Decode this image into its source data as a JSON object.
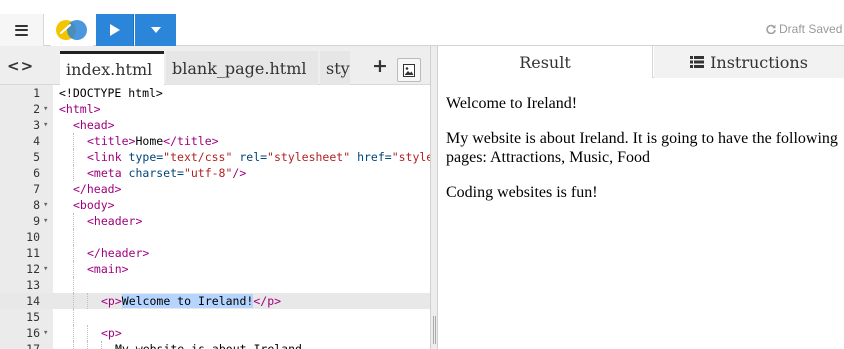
{
  "toolbar": {
    "run_label": "Run",
    "draft_status": "Draft Saved"
  },
  "editor": {
    "tabs": [
      "index.html",
      "blank_page.html",
      "style.css"
    ],
    "lines": [
      {
        "n": "1",
        "fold": "",
        "indent": 0,
        "tokens": [
          [
            "tx",
            "<!DOCTYPE html>"
          ]
        ]
      },
      {
        "n": "2",
        "fold": "▾",
        "indent": 0,
        "tokens": [
          [
            "tg",
            "<html>"
          ]
        ]
      },
      {
        "n": "3",
        "fold": "▾",
        "indent": 1,
        "tokens": [
          [
            "tg",
            "<head>"
          ]
        ]
      },
      {
        "n": "4",
        "fold": "",
        "indent": 2,
        "tokens": [
          [
            "tg",
            "<title>"
          ],
          [
            "tx",
            "Home"
          ],
          [
            "tg",
            "</title>"
          ]
        ]
      },
      {
        "n": "5",
        "fold": "",
        "indent": 2,
        "tokens": [
          [
            "tg",
            "<link "
          ],
          [
            "at",
            "type="
          ],
          [
            "st",
            "\"text/css\""
          ],
          [
            "at",
            " rel="
          ],
          [
            "st",
            "\"stylesheet\""
          ],
          [
            "at",
            " href="
          ],
          [
            "st",
            "\"style.css\""
          ],
          [
            "tg",
            ">"
          ]
        ]
      },
      {
        "n": "6",
        "fold": "",
        "indent": 2,
        "tokens": [
          [
            "tg",
            "<meta "
          ],
          [
            "at",
            "charset="
          ],
          [
            "st",
            "\"utf-8\""
          ],
          [
            "tg",
            "/>"
          ]
        ]
      },
      {
        "n": "7",
        "fold": "",
        "indent": 1,
        "tokens": [
          [
            "tg",
            "</head>"
          ]
        ]
      },
      {
        "n": "8",
        "fold": "▾",
        "indent": 1,
        "tokens": [
          [
            "tg",
            "<body>"
          ]
        ]
      },
      {
        "n": "9",
        "fold": "▾",
        "indent": 2,
        "tokens": [
          [
            "tg",
            "<header>"
          ]
        ]
      },
      {
        "n": "10",
        "fold": "",
        "indent": 2,
        "tokens": []
      },
      {
        "n": "11",
        "fold": "",
        "indent": 2,
        "tokens": [
          [
            "tg",
            "</header>"
          ]
        ]
      },
      {
        "n": "12",
        "fold": "▾",
        "indent": 2,
        "tokens": [
          [
            "tg",
            "<main>"
          ]
        ]
      },
      {
        "n": "13",
        "fold": "",
        "indent": 2,
        "tokens": []
      },
      {
        "n": "14",
        "fold": "",
        "indent": 3,
        "highlight": true,
        "tokens": [
          [
            "tg",
            "<p>"
          ],
          [
            "sel",
            "Welcome to Ireland!"
          ],
          [
            "tg",
            "</p>"
          ]
        ]
      },
      {
        "n": "15",
        "fold": "",
        "indent": 2,
        "tokens": []
      },
      {
        "n": "16",
        "fold": "▾",
        "indent": 3,
        "tokens": [
          [
            "tg",
            "<p>"
          ]
        ]
      },
      {
        "n": "17",
        "fold": "",
        "indent": 4,
        "tokens": [
          [
            "tx",
            "My website is about Ireland."
          ]
        ]
      }
    ]
  },
  "result": {
    "tabs": {
      "result": "Result",
      "instructions": "Instructions"
    },
    "paragraphs": [
      "Welcome to Ireland!",
      "My website is about Ireland. It is going to have the following pages: Attractions, Music, Food",
      "Coding websites is fun!"
    ]
  },
  "colors": {
    "run_button": "#2b85d8",
    "tag": "#a0007e",
    "attribute": "#00457a",
    "string": "#b22222",
    "selection": "#b5d5ff"
  }
}
